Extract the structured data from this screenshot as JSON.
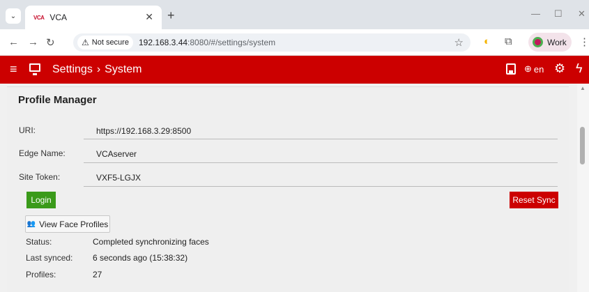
{
  "browser": {
    "tab_title": "VCA",
    "favicon_text": "VCA",
    "not_secure": "Not secure",
    "url_host": "192.168.3.44",
    "url_rest": ":8080/#/settings/system",
    "profile_label": "Work"
  },
  "header": {
    "section": "Settings",
    "separator": "›",
    "page": "System",
    "lang": "en"
  },
  "profile_manager": {
    "title": "Profile Manager",
    "fields": [
      {
        "label": "URI:",
        "value": "https://192.168.3.29:8500"
      },
      {
        "label": "Edge Name:",
        "value": "VCAserver"
      },
      {
        "label": "Site Token:",
        "value": "VXF5-LGJX"
      }
    ],
    "login_label": "Login",
    "reset_label": "Reset Sync",
    "view_faces_label": "View Face Profiles",
    "status": [
      {
        "label": "Status:",
        "value": "Completed synchronizing faces"
      },
      {
        "label": "Last synced:",
        "value": "6 seconds ago (15:38:32)"
      },
      {
        "label": "Profiles:",
        "value": "27"
      }
    ]
  },
  "colors": {
    "brand_red": "#cc0000",
    "login_green": "#3a9a1a"
  }
}
